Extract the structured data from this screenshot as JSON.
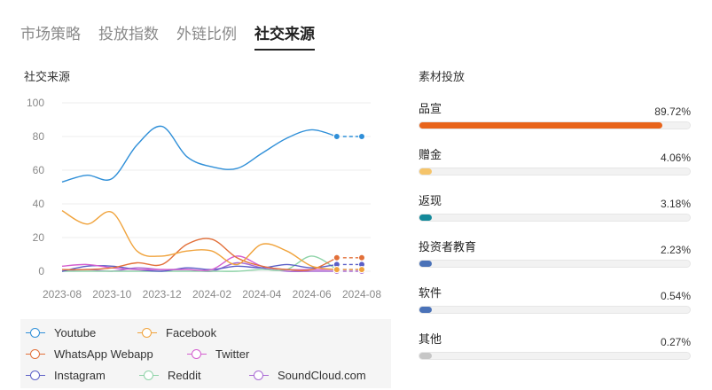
{
  "tabs": [
    {
      "label": "市场策略",
      "active": false
    },
    {
      "label": "投放指数",
      "active": false
    },
    {
      "label": "外链比例",
      "active": false
    },
    {
      "label": "社交来源",
      "active": true
    }
  ],
  "chart_section": {
    "title": "社交来源"
  },
  "assets_section": {
    "title": "素材投放",
    "items": [
      {
        "name": "品宣",
        "percent_label": "89.72%",
        "value": 89.72,
        "color": "#e8641b"
      },
      {
        "name": "赠金",
        "percent_label": "4.06%",
        "value": 4.06,
        "color": "#f5c46a"
      },
      {
        "name": "返现",
        "percent_label": "3.18%",
        "value": 3.18,
        "color": "#14899a"
      },
      {
        "name": "投资者教育",
        "percent_label": "2.23%",
        "value": 2.23,
        "color": "#4a72b8"
      },
      {
        "name": "软件",
        "percent_label": "0.54%",
        "value": 0.54,
        "color": "#4a72b8"
      },
      {
        "name": "其他",
        "percent_label": "0.27%",
        "value": 0.27,
        "color": "#c6c6c6"
      }
    ]
  },
  "chart_data": {
    "type": "line",
    "title": "社交来源",
    "ylim": [
      0,
      100
    ],
    "y_ticks": [
      0,
      20,
      40,
      60,
      80,
      100
    ],
    "x_tick_labels": [
      "2023-08",
      "2023-10",
      "2023-12",
      "2024-02",
      "2024-04",
      "2024-06",
      "2024-08"
    ],
    "x": [
      "2023-08",
      "2023-09",
      "2023-10",
      "2023-11",
      "2023-12",
      "2024-01",
      "2024-02",
      "2024-03",
      "2024-04",
      "2024-05",
      "2024-06",
      "2024-07",
      "2024-08"
    ],
    "grid": true,
    "legend_position": "bottom",
    "series": [
      {
        "name": "Youtube",
        "color": "#2f8fd8",
        "values": [
          53,
          57,
          55,
          75,
          86,
          68,
          62,
          61,
          70,
          79,
          84,
          80,
          80
        ]
      },
      {
        "name": "Facebook",
        "color": "#f0a33c",
        "values": [
          36,
          28,
          35,
          12,
          9,
          12,
          12,
          4,
          16,
          12,
          3,
          1,
          1
        ]
      },
      {
        "name": "WhatsApp Webapp",
        "color": "#e2703a",
        "values": [
          1,
          1,
          2,
          5,
          4,
          16,
          19,
          8,
          3,
          1,
          1,
          8,
          8
        ]
      },
      {
        "name": "Twitter",
        "color": "#d45fcf",
        "values": [
          3,
          4,
          2,
          1,
          1,
          1,
          1,
          9,
          3,
          1,
          1,
          1,
          1
        ]
      },
      {
        "name": "Instagram",
        "color": "#5b5fc7",
        "values": [
          0,
          3,
          3,
          1,
          0,
          2,
          1,
          3,
          2,
          4,
          2,
          4,
          4
        ]
      },
      {
        "name": "Reddit",
        "color": "#8fd3a8",
        "values": [
          0,
          0,
          0,
          0,
          0,
          0,
          0,
          0,
          1,
          1,
          9,
          1,
          1
        ]
      },
      {
        "name": "SoundCloud.com",
        "color": "#a96ad4",
        "values": [
          0,
          1,
          0,
          2,
          1,
          1,
          0,
          5,
          2,
          0,
          0,
          0,
          0
        ]
      }
    ],
    "projected_from_index": 11
  }
}
